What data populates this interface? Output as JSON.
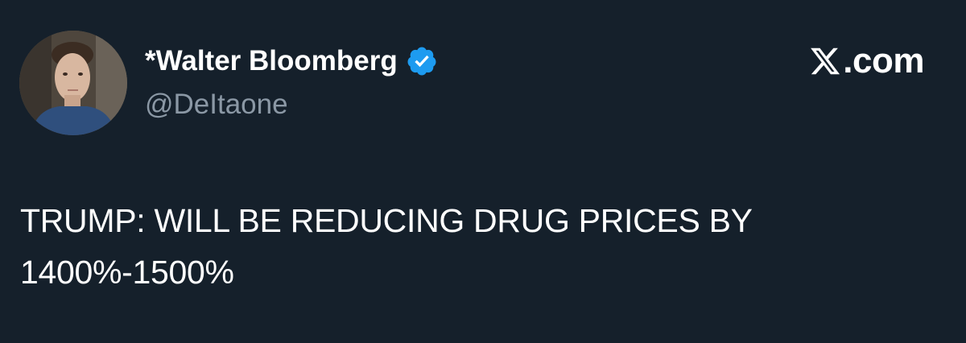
{
  "author": {
    "display_name": "*Walter Bloomberg",
    "handle": "@DeItaone",
    "verified": true,
    "avatar_icon": "profile-photo"
  },
  "brand": {
    "logo_icon": "x-logo-icon",
    "suffix": ".com"
  },
  "tweet": {
    "lines": [
      "TRUMP: WILL BE REDUCING DRUG PRICES BY",
      "1400%-1500%"
    ]
  },
  "colors": {
    "background": "#15202b",
    "text": "#ffffff",
    "secondary_text": "#8b98a5",
    "verified_blue": "#1d9bf0"
  }
}
